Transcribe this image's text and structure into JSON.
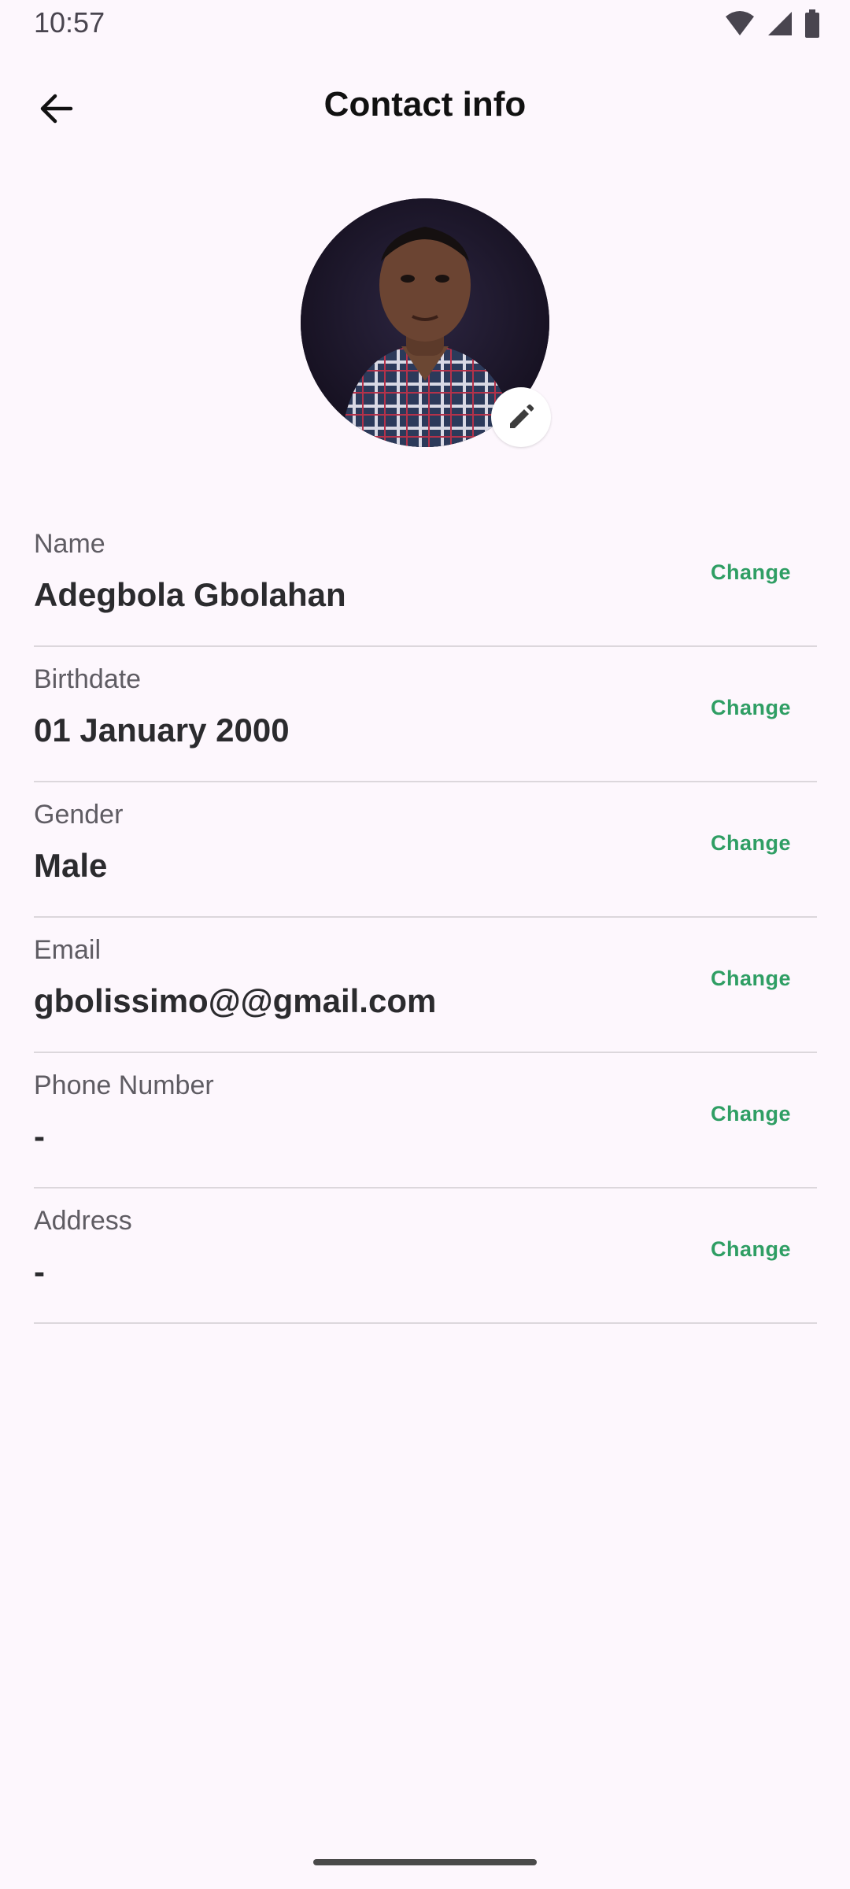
{
  "status_bar": {
    "time": "10:57",
    "icons": [
      "wifi-icon",
      "signal-icon",
      "battery-icon"
    ]
  },
  "header": {
    "title": "Contact info",
    "back_icon": "arrow-back-icon"
  },
  "profile": {
    "edit_icon": "pencil-icon"
  },
  "fields": [
    {
      "label": "Name",
      "value": "Adegbola Gbolahan",
      "action": "Change"
    },
    {
      "label": "Birthdate",
      "value": "01 January 2000",
      "action": "Change"
    },
    {
      "label": "Gender",
      "value": "Male",
      "action": "Change"
    },
    {
      "label": "Email",
      "value": "gbolissimo@@gmail.com",
      "action": "Change"
    },
    {
      "label": "Phone Number",
      "value": "-",
      "action": "Change"
    },
    {
      "label": "Address",
      "value": "-",
      "action": "Change"
    }
  ],
  "colors": {
    "background": "#fdf7fd",
    "accent": "#2f9e64",
    "text": "#2b2b2e",
    "divider": "#dcd7dc"
  }
}
